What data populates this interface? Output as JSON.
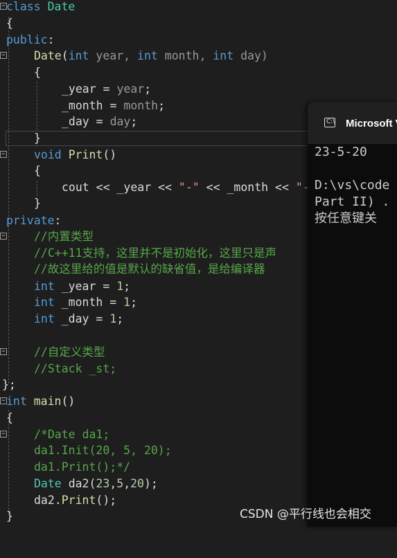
{
  "editor": {
    "lines": {
      "l01": {
        "a": "class",
        "b": " Date"
      },
      "l02": {
        "a": "{"
      },
      "l03": {
        "a": "public",
        "b": ":"
      },
      "l04": {
        "a": "Date",
        "b": "(",
        "c": "int",
        "d": " year, ",
        "e": "int",
        "f": " month, ",
        "g": "int",
        "h": " day)"
      },
      "l05": {
        "a": "{"
      },
      "l06": {
        "a": "_year",
        "b": " = ",
        "c": "year",
        "d": ";"
      },
      "l07": {
        "a": "_month",
        "b": " = ",
        "c": "month",
        "d": ";"
      },
      "l08": {
        "a": "_day",
        "b": " = ",
        "c": "day",
        "d": ";"
      },
      "l09": {
        "a": "}"
      },
      "l10": {
        "a": "void",
        "b": " ",
        "c": "Print",
        "d": "()"
      },
      "l11": {
        "a": "{"
      },
      "l12": {
        "a": "cout",
        "b": " << ",
        "c": "_year",
        "d": " << ",
        "e": "\"-\"",
        "f": " << ",
        "g": "_month",
        "h": " << ",
        "i": "\"-"
      },
      "l13": {
        "a": "}"
      },
      "l14": {
        "a": "private",
        "b": ":"
      },
      "l15": {
        "a": "//内置类型"
      },
      "l16": {
        "a": "//C++11支持，这里并不是初始化，这里只是声"
      },
      "l17": {
        "a": "//故这里给的值是默认的缺省值，是给编译器"
      },
      "l18": {
        "a": "int",
        "b": " ",
        "c": "_year",
        "d": " = ",
        "e": "1",
        "f": ";"
      },
      "l19": {
        "a": "int",
        "b": " ",
        "c": "_month",
        "d": " = ",
        "e": "1",
        "f": ";"
      },
      "l20": {
        "a": "int",
        "b": " ",
        "c": "_day",
        "d": " = ",
        "e": "1",
        "f": ";"
      },
      "l21": {},
      "l22": {
        "a": "//自定义类型"
      },
      "l23": {
        "a": "//Stack _st;"
      },
      "l24": {
        "a": "};"
      },
      "l25": {
        "a": "int",
        "b": " ",
        "c": "main",
        "d": "()"
      },
      "l26": {
        "a": "{"
      },
      "l27": {
        "a": "/*Date da1;"
      },
      "l28": {
        "a": "da1.Init(20, 5, 20);"
      },
      "l29": {
        "a": "da1.Print();*/"
      },
      "l30": {
        "a": "Date",
        "b": " ",
        "c": "da2",
        "d": "(",
        "e": "23",
        "f": ",",
        "g": "5",
        "h": ",",
        "i": "20",
        "j": ");"
      },
      "l31": {
        "a": "da2",
        "b": ".",
        "c": "Print",
        "d": "();"
      },
      "l32": {
        "a": "}"
      }
    }
  },
  "console": {
    "title": "Microsoft Visual Studio 调试控制台",
    "icon": "terminal-icon",
    "output": [
      "23-5-20",
      "",
      "D:\\vs\\code",
      "Part II) .",
      "按任意键关"
    ]
  },
  "watermark": "CSDN @平行线也会相交",
  "colors": {
    "background": "#1e1e1e",
    "keyword": "#569cd6",
    "type": "#4ec9b0",
    "function": "#dcdcaa",
    "comment": "#57a64a",
    "number": "#b5cea8",
    "string": "#d69d85",
    "console_bg": "#0c0c0c"
  }
}
